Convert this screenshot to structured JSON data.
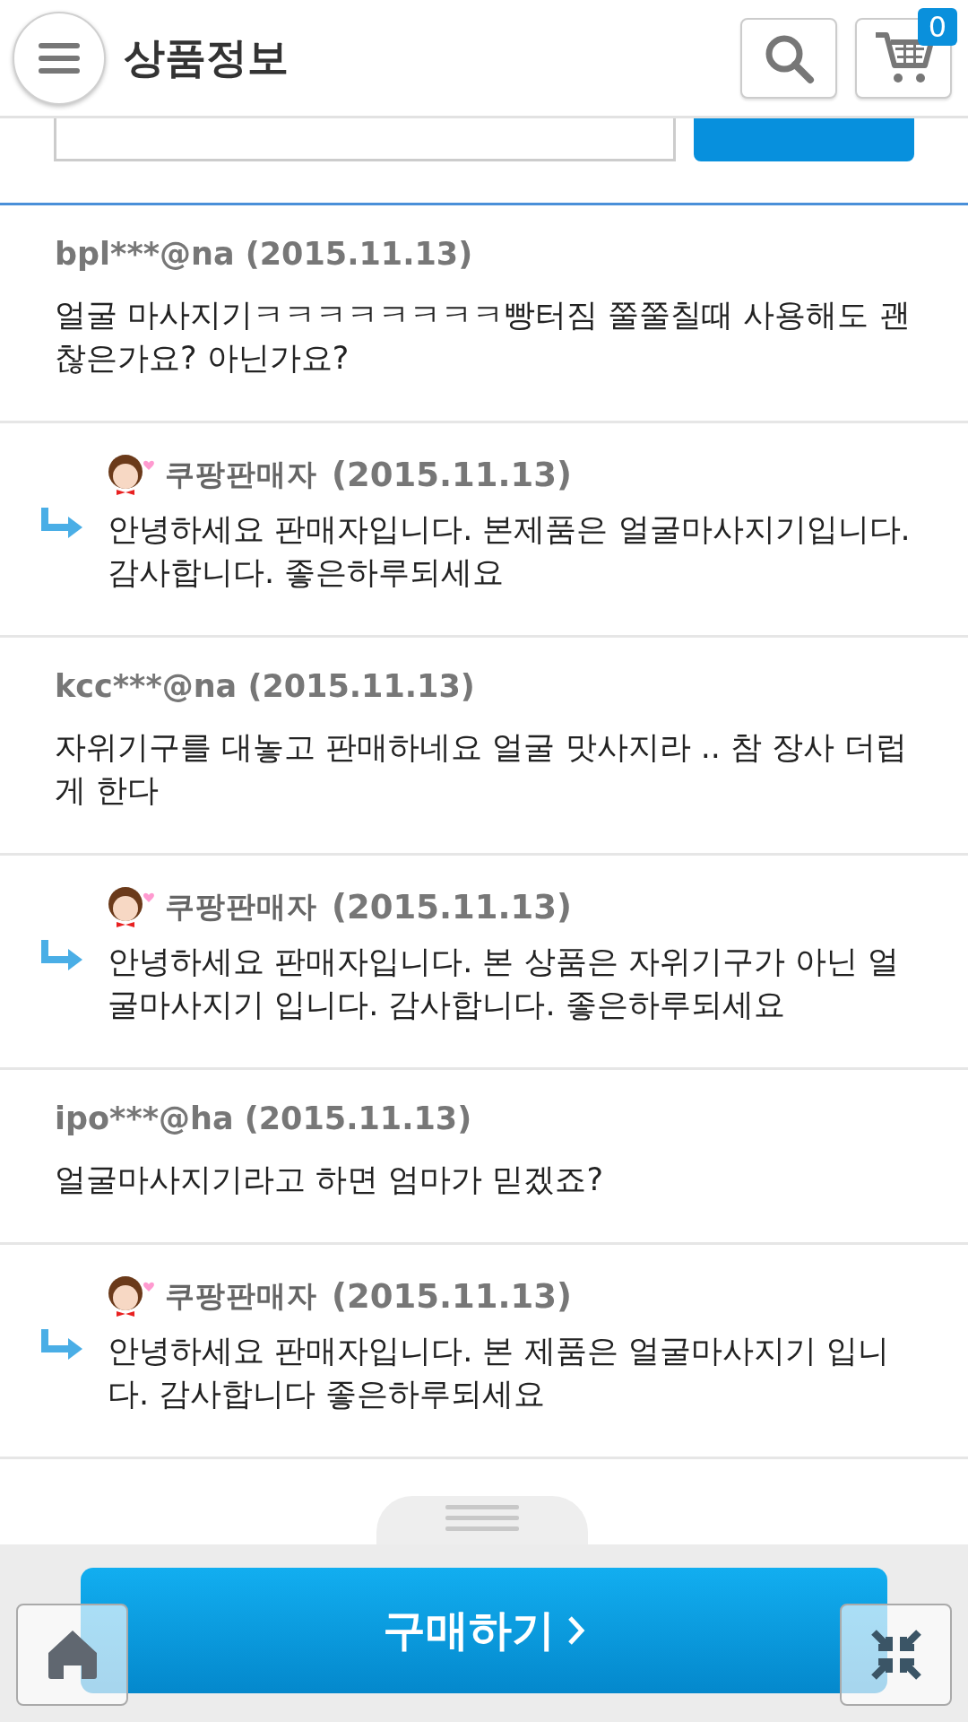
{
  "header": {
    "title": "상품정보",
    "cart_count": "0"
  },
  "comments": [
    {
      "kind": "question",
      "meta": "bpl***@na (2015.11.13)",
      "text": "얼굴 마사지기ㅋㅋㅋㅋㅋㅋㅋㅋ빵터짐 쭐쭐칠때 사용해도 괜찮은가요? 아닌가요?"
    },
    {
      "kind": "reply",
      "author": "쿠팡판매자",
      "date": "(2015.11.13)",
      "text": "안녕하세요 판매자입니다. 본제품은 얼굴마사지기입니다. 감사합니다. 좋은하루되세요"
    },
    {
      "kind": "question",
      "meta": "kcc***@na (2015.11.13)",
      "text": "자위기구를 대놓고 판매하네요 얼굴 맛사지라 .. 참 장사 더럽게 한다"
    },
    {
      "kind": "reply",
      "author": "쿠팡판매자",
      "date": "(2015.11.13)",
      "text": "안녕하세요 판매자입니다. 본 상품은 자위기구가 아닌 얼굴마사지기 입니다. 감사합니다. 좋은하루되세요"
    },
    {
      "kind": "question",
      "meta": "ipo***@ha (2015.11.13)",
      "text": "얼굴마사지기라고 하면 엄마가 믿겠죠?"
    },
    {
      "kind": "reply",
      "author": "쿠팡판매자",
      "date": "(2015.11.13)",
      "text": "안녕하세요 판매자입니다. 본 제품은 얼굴마사지기 입니다. 감사합니다 좋은하루되세요"
    }
  ],
  "buy_button": {
    "label": "구매하기"
  }
}
